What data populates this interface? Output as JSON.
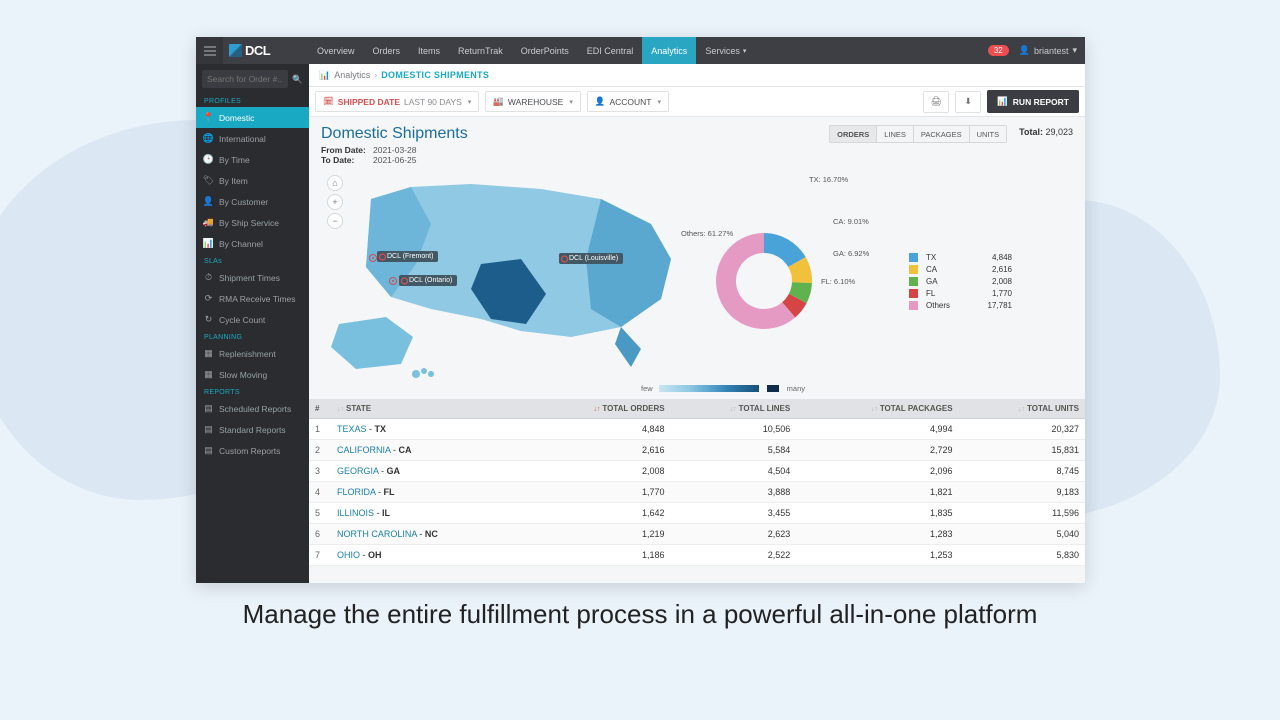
{
  "brand": "DCL",
  "nav": {
    "items": [
      "Overview",
      "Orders",
      "Items",
      "ReturnTrak",
      "OrderPoints",
      "EDI Central",
      "Analytics",
      "Services"
    ],
    "active": 6,
    "services_caret": true
  },
  "notif_count": "32",
  "user": "briantest",
  "search": {
    "placeholder": "Search for Order #..."
  },
  "sidebar": {
    "sections": [
      {
        "label": "PROFILES",
        "items": [
          {
            "icon": "📍",
            "label": "Domestic",
            "active": true
          },
          {
            "icon": "🌐",
            "label": "International"
          },
          {
            "icon": "🕒",
            "label": "By Time"
          },
          {
            "icon": "🏷",
            "label": "By Item"
          },
          {
            "icon": "👤",
            "label": "By Customer"
          },
          {
            "icon": "🚚",
            "label": "By Ship Service"
          },
          {
            "icon": "📊",
            "label": "By Channel"
          }
        ]
      },
      {
        "label": "SLAs",
        "items": [
          {
            "icon": "⏱",
            "label": "Shipment Times"
          },
          {
            "icon": "⟳",
            "label": "RMA Receive Times"
          },
          {
            "icon": "↻",
            "label": "Cycle Count"
          }
        ]
      },
      {
        "label": "PLANNING",
        "items": [
          {
            "icon": "▦",
            "label": "Replenishment"
          },
          {
            "icon": "▦",
            "label": "Slow Moving"
          }
        ]
      },
      {
        "label": "REPORTS",
        "items": [
          {
            "icon": "▤",
            "label": "Scheduled Reports"
          },
          {
            "icon": "▤",
            "label": "Standard Reports"
          },
          {
            "icon": "▤",
            "label": "Custom Reports"
          }
        ]
      }
    ]
  },
  "crumbs": {
    "icon": "📊",
    "a": "Analytics",
    "b": "DOMESTIC SHIPMENTS"
  },
  "filters": {
    "shipped": {
      "label": "SHIPPED DATE",
      "sub": "LAST 90 DAYS"
    },
    "warehouse": "WAREHOUSE",
    "account": "ACCOUNT",
    "run": "RUN REPORT"
  },
  "page": {
    "title": "Domestic Shipments",
    "from_lbl": "From Date:",
    "to_lbl": "To Date:",
    "from": "2021-03-28",
    "to": "2021-06-25",
    "segments": [
      "ORDERS",
      "LINES",
      "PACKAGES",
      "UNITS"
    ],
    "seg_active": 0,
    "total_lbl": "Total:",
    "total": "29,023",
    "map_labels": {
      "fremont": "DCL (Fremont)",
      "ontario": "DCL (Ontario)",
      "louisville": "DCL (Louisville)"
    },
    "legend": {
      "few": "few",
      "many": "many"
    }
  },
  "chart_data": {
    "type": "pie",
    "title": "",
    "series": [
      {
        "name": "TX",
        "value": 4848,
        "pct": "16.70%",
        "color": "#4aa3d8"
      },
      {
        "name": "CA",
        "value": 2616,
        "pct": "9.01%",
        "color": "#f2c13c"
      },
      {
        "name": "GA",
        "value": 2008,
        "pct": "6.92%",
        "color": "#5fb24e"
      },
      {
        "name": "FL",
        "value": 1770,
        "pct": "6.10%",
        "color": "#d64545"
      },
      {
        "name": "Others",
        "value": 17781,
        "pct": "61.27%",
        "color": "#e59ac4"
      }
    ]
  },
  "table": {
    "headers": [
      "#",
      "STATE",
      "TOTAL ORDERS",
      "TOTAL LINES",
      "TOTAL PACKAGES",
      "TOTAL UNITS"
    ],
    "rows": [
      {
        "n": "1",
        "state": "TEXAS",
        "code": "TX",
        "orders": "4,848",
        "lines": "10,506",
        "packages": "4,994",
        "units": "20,327"
      },
      {
        "n": "2",
        "state": "CALIFORNIA",
        "code": "CA",
        "orders": "2,616",
        "lines": "5,584",
        "packages": "2,729",
        "units": "15,831"
      },
      {
        "n": "3",
        "state": "GEORGIA",
        "code": "GA",
        "orders": "2,008",
        "lines": "4,504",
        "packages": "2,096",
        "units": "8,745"
      },
      {
        "n": "4",
        "state": "FLORIDA",
        "code": "FL",
        "orders": "1,770",
        "lines": "3,888",
        "packages": "1,821",
        "units": "9,183"
      },
      {
        "n": "5",
        "state": "ILLINOIS",
        "code": "IL",
        "orders": "1,642",
        "lines": "3,455",
        "packages": "1,835",
        "units": "11,596"
      },
      {
        "n": "6",
        "state": "NORTH CAROLINA",
        "code": "NC",
        "orders": "1,219",
        "lines": "2,623",
        "packages": "1,283",
        "units": "5,040"
      },
      {
        "n": "7",
        "state": "OHIO",
        "code": "OH",
        "orders": "1,186",
        "lines": "2,522",
        "packages": "1,253",
        "units": "5,830"
      }
    ]
  },
  "caption": "Manage the entire fulfillment process in a powerful all-in-one platform"
}
